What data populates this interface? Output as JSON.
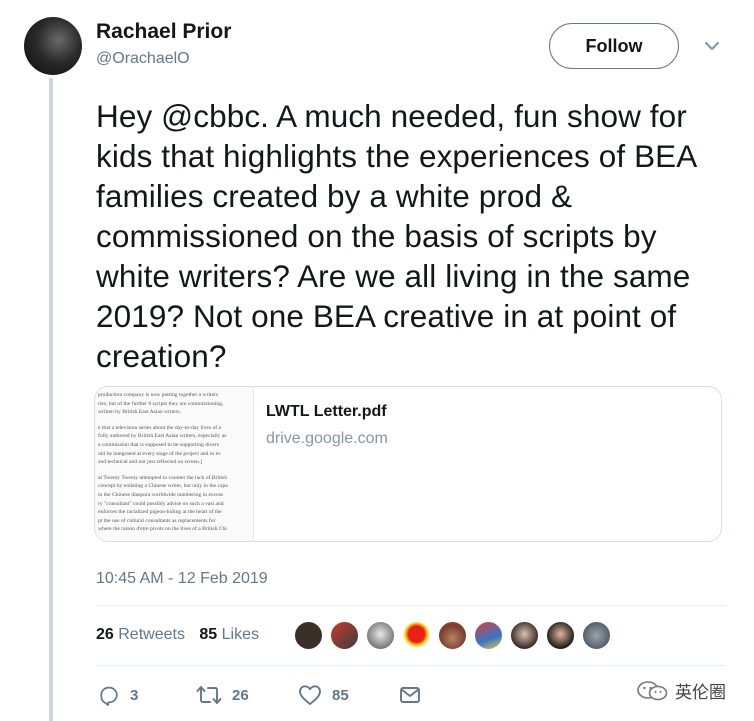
{
  "tweet": {
    "author_name": "Rachael Prior",
    "author_handle": "@OrachaelO",
    "follow_label": "Follow",
    "text": "Hey @cbbc. A much needed, fun show for kids that highlights the experiences of BEA families created by a white prod & commissioned on the basis of scripts by white writers? Are we all living in the same 2019? Not one BEA creative in at point of creation?",
    "timestamp": "10:45 AM - 12 Feb 2019"
  },
  "card": {
    "title": "LWTL Letter.pdf",
    "domain": "drive.google.com",
    "thumbnail_text": [
      "production company is now putting together a writers",
      "ries, but of the further 8 scripts they are commissioning,",
      "written by British East Asian writers.",
      "e that a television series about the day-to-day lives of a",
      "fully authored by British East Asian writers, especially as",
      "a commission that is supposed to be supporting divers",
      "uld be integrated at every stage of the project and in ev",
      "and technical and not just reflected on screen.]",
      "at Twenty Twenty attempted to counter the lack of British",
      "concept by enlisting a Chinese writer, but only in the capa",
      "in the Chinese diaspora worldwide numbering in excess",
      "ry \"consultant\" could possibly advise on such a vast and",
      "enforces the racialized pigeon-holing at the heart of the",
      "pt the use of cultural consultants as replacements for",
      "where the raison d'etre pivots on the lives of a British Chi",
      "e that Cheryl Taylor received a number of emails from"
    ]
  },
  "stats": {
    "retweets_count": "26",
    "retweets_label": "Retweets",
    "likes_count": "85",
    "likes_label": "Likes"
  },
  "actions": {
    "reply_count": "3",
    "retweet_count": "26",
    "like_count": "85"
  },
  "watermark": {
    "text": "英伦圈"
  },
  "colors": {
    "text_primary": "#14171a",
    "text_secondary": "#657786",
    "border": "#e6ecf0",
    "thread_line": "#ccd6dd"
  }
}
